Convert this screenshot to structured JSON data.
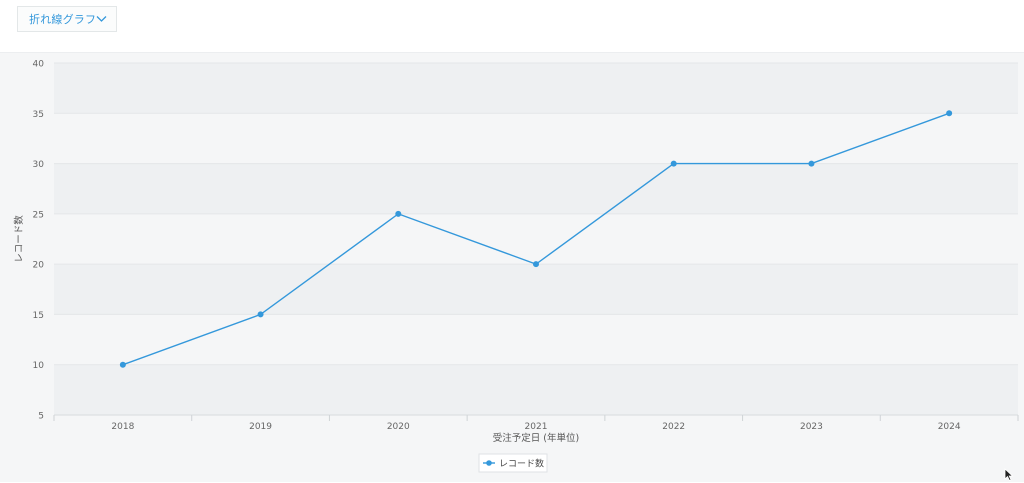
{
  "toolbar": {
    "chart_type_select": {
      "value": "折れ線グラフ",
      "icon": "chevron-down-icon"
    }
  },
  "colors": {
    "series": "#3498db",
    "band_dark": "#eef0f2",
    "band_light": "#f5f6f7",
    "axis_text": "#666666"
  },
  "chart_data": {
    "type": "line",
    "categories": [
      "2018",
      "2019",
      "2020",
      "2021",
      "2022",
      "2023",
      "2024"
    ],
    "series": [
      {
        "name": "レコード数",
        "values": [
          10,
          15,
          25,
          20,
          30,
          30,
          35
        ]
      }
    ],
    "xlabel": "受注予定日 (年単位)",
    "ylabel": "レコード数",
    "ylim": [
      5,
      40
    ],
    "yticks": [
      5,
      10,
      15,
      20,
      25,
      30,
      35,
      40
    ],
    "grid": "alternating horizontal bands",
    "legend": "bottom-center"
  }
}
